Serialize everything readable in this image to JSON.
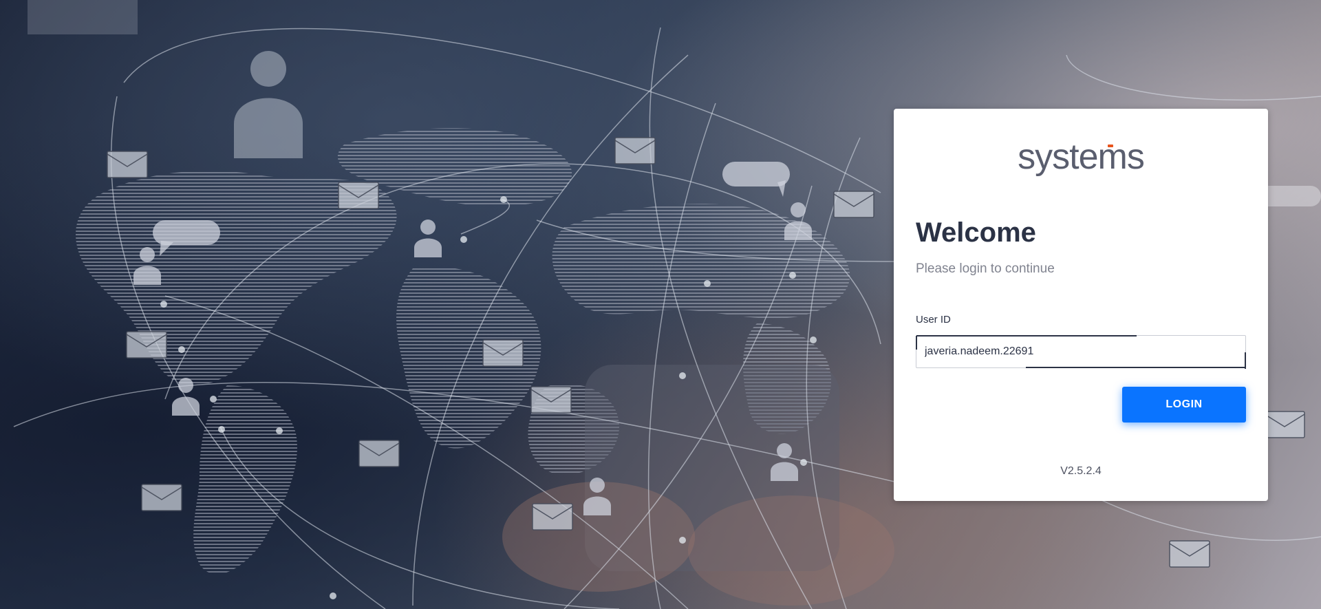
{
  "logo": {
    "text": "systems",
    "accent_color": "#e8541c"
  },
  "login": {
    "heading": "Welcome",
    "subtitle": "Please login to continue",
    "user_id_label": "User ID",
    "user_id_value": "javeria.nadeem.22691",
    "login_button_label": "LOGIN",
    "version": "V2.5.2.4"
  },
  "colors": {
    "primary_button": "#0a74ff",
    "heading": "#2b3245"
  },
  "background": {
    "icons": [
      "envelope-icon",
      "user-icon",
      "chat-bubble-icon",
      "world-map"
    ]
  }
}
